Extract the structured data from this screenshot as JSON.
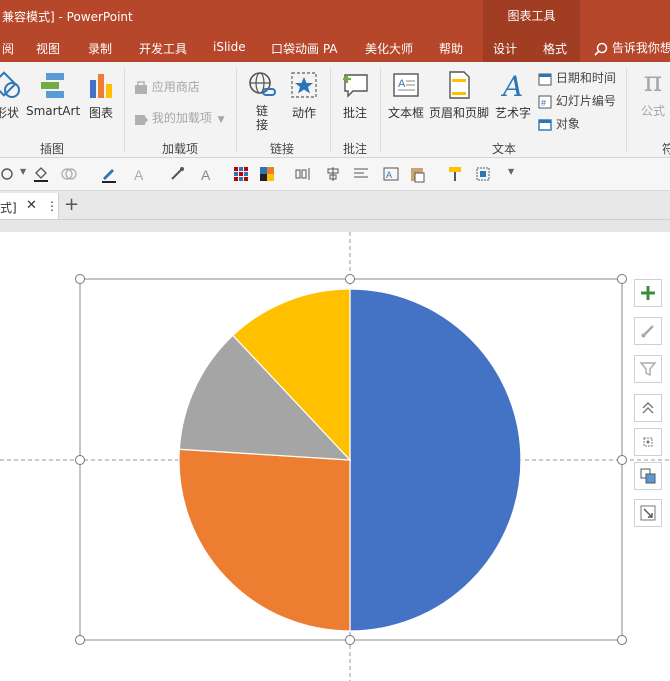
{
  "window": {
    "title": "兼容模式] - PowerPoint",
    "context_title": "图表工具"
  },
  "tabs": [
    {
      "label": "阅"
    },
    {
      "label": "视图"
    },
    {
      "label": "录制"
    },
    {
      "label": "开发工具"
    },
    {
      "label": "iSlide"
    },
    {
      "label": "口袋动画 PA"
    },
    {
      "label": "美化大师"
    },
    {
      "label": "帮助"
    },
    {
      "label": "设计"
    },
    {
      "label": "格式"
    }
  ],
  "search": {
    "label": "告诉我你想"
  },
  "ribbon": {
    "shapes_label": "形状",
    "smartart_label": "SmartArt",
    "chart_label": "图表",
    "group_illustrations": "插图",
    "app_store_label": "应用商店",
    "my_addins_label": "我的加载项",
    "group_addins": "加载项",
    "link_label": "链接",
    "link_label_2": "接",
    "action_label": "动作",
    "group_links": "链接",
    "comment_label": "批注",
    "group_comments": "批注",
    "textbox_label": "文本框",
    "header_footer_label": "页眉和页脚",
    "wordart_label": "艺术字",
    "datetime_label": "日期和时间",
    "slide_number_label": "幻灯片编号",
    "object_label": "对象",
    "group_text": "文本",
    "formula_label": "公式",
    "group_symbols": "符"
  },
  "doc_tab": {
    "label": "式]"
  },
  "colors": {
    "accent": "#b7472a",
    "pie_blue": "#4472c4",
    "pie_orange": "#ed7d31",
    "pie_gray": "#a5a5a5",
    "pie_yellow": "#ffc000"
  },
  "chart_data": {
    "type": "pie",
    "categories": [
      "",
      "",
      "",
      ""
    ],
    "values": [
      50,
      26,
      12,
      12
    ],
    "colors": [
      "#4472c4",
      "#ed7d31",
      "#a5a5a5",
      "#ffc000"
    ],
    "title": "",
    "legend": "none"
  },
  "icons": {
    "side_buttons": [
      "add-element-icon",
      "chart-style-brush-icon",
      "chart-filter-icon",
      "bring-forward-icon",
      "align-icon",
      "arrange-icon",
      "crop-icon"
    ]
  }
}
